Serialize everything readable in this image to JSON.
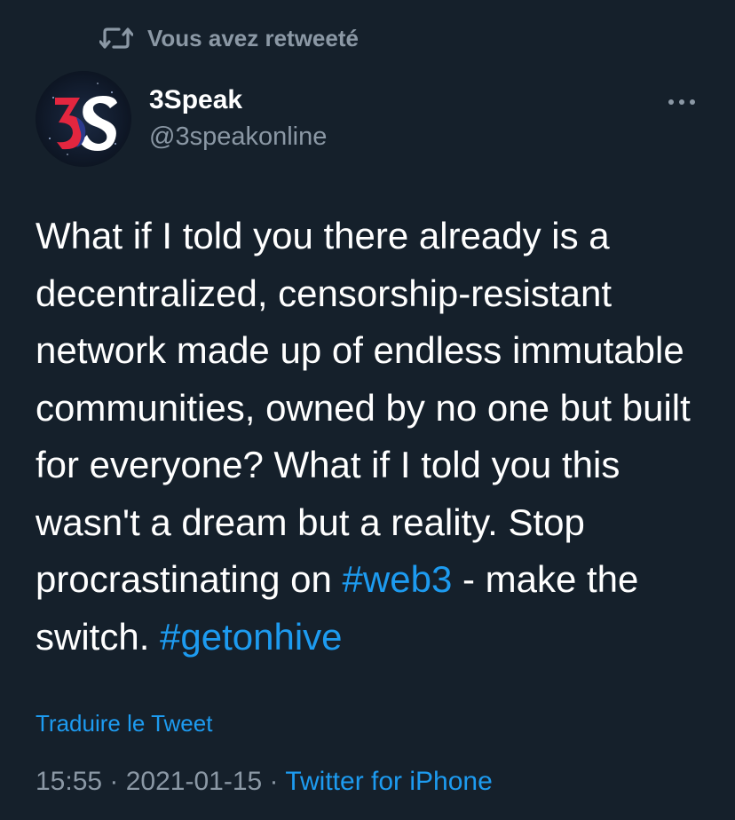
{
  "retweet": {
    "icon": "retweet-icon",
    "label": "Vous avez retweeté"
  },
  "author": {
    "avatar_icon": "3speak-logo",
    "avatar_text": "3S",
    "name": "3Speak",
    "handle": "@3speakonline"
  },
  "menu": {
    "icon": "more-options-icon"
  },
  "tweet": {
    "text_before_tag1": "What if I told you there already is a decentralized, censorship-resistant network made up of endless immutable communities, owned by no one but built for everyone? What if I told you this wasn't a dream but a reality. Stop procrastinating on ",
    "hashtag1": "#web3",
    "text_between_tags": " - make the switch. ",
    "hashtag2": "#getonhive"
  },
  "translate": {
    "label": "Traduire le Tweet"
  },
  "meta": {
    "time": "15:55",
    "separator": " · ",
    "date": "2021-01-15",
    "source": "Twitter for iPhone"
  },
  "colors": {
    "background": "#15202b",
    "text": "#ffffff",
    "secondary": "#8b98a5",
    "accent": "#1d9bf0",
    "logo_red": "#e3263f",
    "logo_navy": "#2b3a8c",
    "logo_white": "#ffffff"
  }
}
